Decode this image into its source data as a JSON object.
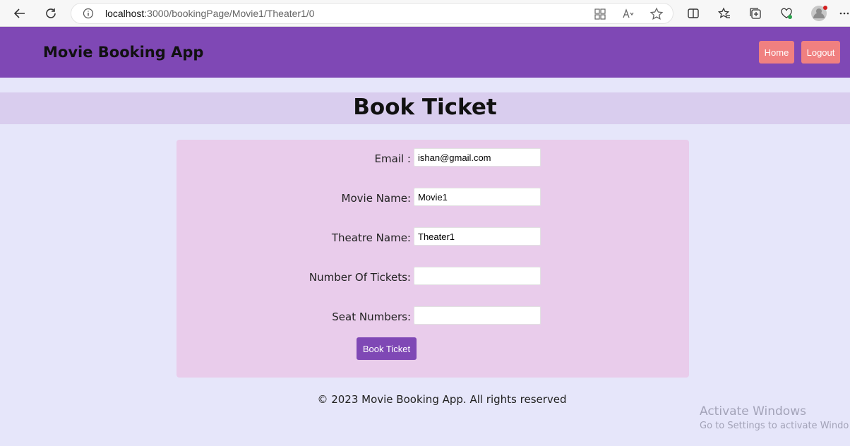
{
  "browser": {
    "url_host": "localhost",
    "url_path": ":3000/bookingPage/Movie1/Theater1/0"
  },
  "header": {
    "brand": "Movie Booking App",
    "home_label": "Home",
    "logout_label": "Logout"
  },
  "page": {
    "title": "Book Ticket"
  },
  "form": {
    "email_label": "Email :",
    "email_value": "ishan@gmail.com",
    "movie_label": "Movie Name:",
    "movie_value": "Movie1",
    "theatre_label": "Theatre Name:",
    "theatre_value": "Theater1",
    "tickets_label": "Number Of Tickets:",
    "tickets_value": "",
    "seats_label": "Seat Numbers:",
    "seats_value": "",
    "submit_label": "Book Ticket"
  },
  "footer": {
    "text": "© 2023 Movie Booking App. All rights reserved"
  },
  "watermark": {
    "line1": "Activate Windows",
    "line2": "Go to Settings to activate Windo"
  },
  "colors": {
    "header_bg": "#7f48b5",
    "nav_button": "#f08080",
    "page_bg": "#e6e6fa",
    "title_band": "#d9cdee",
    "form_bg": "#e9cceb",
    "submit_bg": "#7f48b5"
  }
}
